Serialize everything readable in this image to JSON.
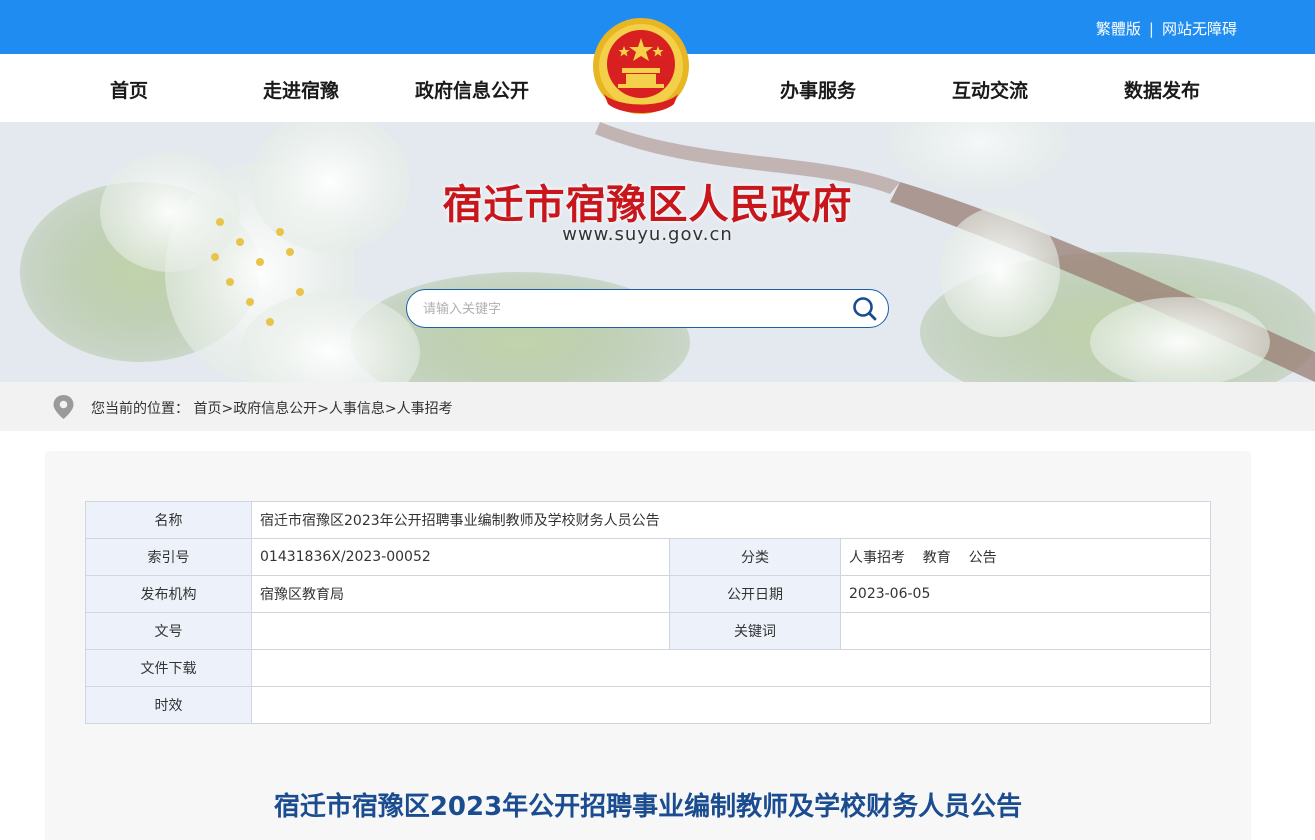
{
  "toplinks": {
    "traditional": "繁體版",
    "separator": "|",
    "accessibility": "网站无障碍"
  },
  "nav": {
    "left": [
      "首页",
      "走进宿豫",
      "政府信息公开"
    ],
    "right": [
      "办事服务",
      "互动交流",
      "数据发布"
    ]
  },
  "banner": {
    "title": "宿迁市宿豫区人民政府",
    "url": "www.suyu.gov.cn"
  },
  "search": {
    "placeholder": "请输入关键字",
    "icon": "search-icon"
  },
  "breadcrumb": {
    "prefix": "您当前的位置：",
    "items": [
      "首页",
      "政府信息公开",
      "人事信息",
      "人事招考"
    ],
    "separator": ">"
  },
  "meta": {
    "name_label": "名称",
    "name_value": "宿迁市宿豫区2023年公开招聘事业编制教师及学校财务人员公告",
    "index_label": "索引号",
    "index_value": "01431836X/2023-00052",
    "category_label": "分类",
    "category_value": "人事招考    教育    公告",
    "publisher_label": "发布机构",
    "publisher_value": "宿豫区教育局",
    "date_label": "公开日期",
    "date_value": "2023-06-05",
    "docno_label": "文号",
    "docno_value": "",
    "keyword_label": "关键词",
    "keyword_value": "",
    "download_label": "文件下载",
    "download_value": "",
    "validity_label": "时效",
    "validity_value": ""
  },
  "article": {
    "title": "宿迁市宿豫区2023年公开招聘事业编制教师及学校财务人员公告"
  },
  "colors": {
    "topbar": "#1e8cf0",
    "title_red": "#c8161d",
    "article_blue": "#1a4c8f",
    "label_bg": "#edf2fa"
  }
}
